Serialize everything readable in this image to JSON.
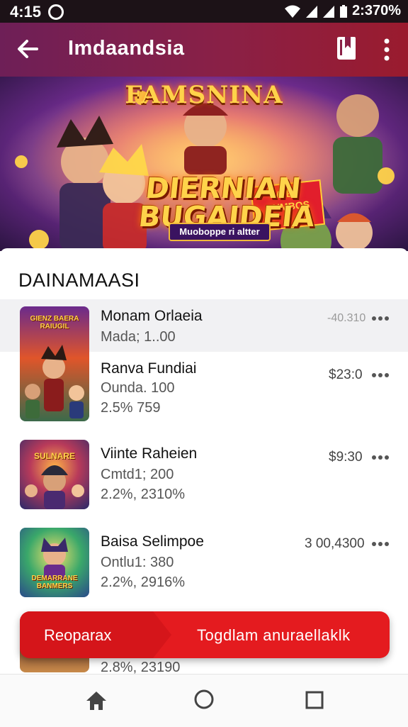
{
  "status_bar": {
    "time": "4:15",
    "battery": "2:370%"
  },
  "app_bar": {
    "title": "Imdaandsia"
  },
  "banner": {
    "top_title": "FAMSNINA",
    "badge": "VAEN BUMBOS",
    "main_title": "DIERNIAN BUGAIDEIA",
    "ribbon": "Muoboppe ri altter"
  },
  "section": {
    "title": "DAINAMAASI"
  },
  "items": [
    {
      "title": "Monam Orlaeia",
      "sub1": "Mada; 1..00",
      "sub2": "",
      "price": "-40.310",
      "thumb_text": "GIENZ BAERA RAIUGIL"
    },
    {
      "title": "Ranva Fundiai",
      "sub1": "Ounda. 100",
      "sub2": "2.5% 759",
      "price": "$23:0"
    },
    {
      "title": "Viinte Raheien",
      "sub1": "Cmtd1; 200",
      "sub2": "2.2%, 2310%",
      "price": "$9:30",
      "thumb_text": "SULNARE"
    },
    {
      "title": "Baisa Selimpoe",
      "sub1": "Ontlu1: 380",
      "sub2": "2.2%, 2916%",
      "price": "3 00,4300",
      "thumb_text": "DEMARRANE BANMERS"
    },
    {
      "sub2": "2.8%, 23190"
    }
  ],
  "snackbar": {
    "action": "Reoparax",
    "message": "Togdlam anuraellaklk"
  },
  "colors": {
    "appbar": "#8a2046",
    "snackbar": "#e41b1f",
    "banner_gold": "#ffd34a"
  },
  "icons": [
    "arrow-back-icon",
    "book-icon",
    "more-vert-icon",
    "more-horiz-icon",
    "home-icon",
    "circle-icon",
    "square-icon",
    "wifi-icon",
    "signal-icon",
    "battery-icon"
  ]
}
